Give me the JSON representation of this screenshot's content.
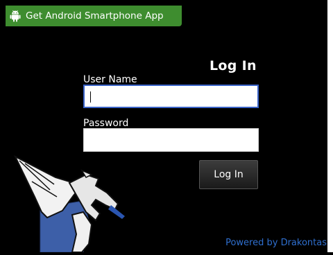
{
  "banner": {
    "label": "Get Android Smartphone App",
    "icon": "android-icon"
  },
  "login": {
    "title": "Log In",
    "username_label": "User Name",
    "password_label": "Password",
    "button_label": "Log In"
  },
  "logo": {
    "icon": "dragon-logo-icon"
  },
  "footer": {
    "powered_by": "Powered by Drakontas"
  }
}
